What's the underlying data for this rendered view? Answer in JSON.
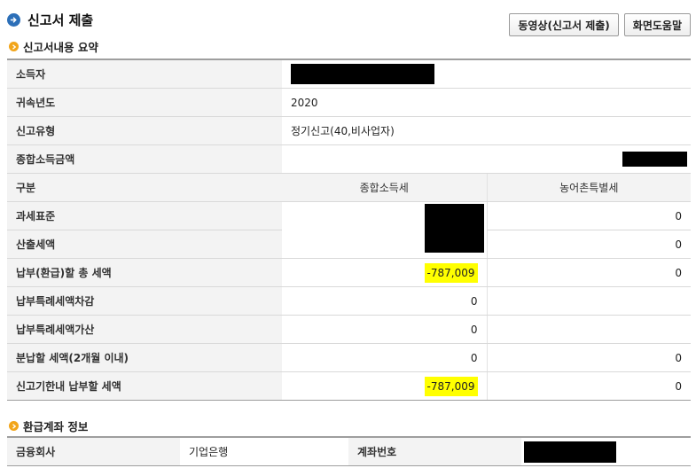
{
  "header": {
    "title": "신고서 제출",
    "icon": "arrow-right-circle-icon"
  },
  "buttons": {
    "video": "동영상(신고서 제출)",
    "help": "화면도움말"
  },
  "summary": {
    "title": "신고서내용 요약",
    "income_earner_label": "소득자",
    "year_label": "귀속년도",
    "year_value": "2020",
    "type_label": "신고유형",
    "type_value": "정기신고(40,비사업자)",
    "total_income_label": "종합소득금액",
    "columns": {
      "category": "구분",
      "income_tax": "종합소득세",
      "rural_tax": "농어촌특별세"
    },
    "rows": [
      {
        "label": "과세표준",
        "income_tax": "",
        "rural_tax": "0"
      },
      {
        "label": "산출세액",
        "income_tax": "",
        "rural_tax": "0"
      },
      {
        "label": "납부(환급)할 총 세액",
        "income_tax": "-787,009",
        "rural_tax": "0"
      },
      {
        "label": "납부특례세액차감",
        "income_tax": "0",
        "rural_tax": ""
      },
      {
        "label": "납부특례세액가산",
        "income_tax": "0",
        "rural_tax": ""
      },
      {
        "label": "분납할 세액(2개월 이내)",
        "income_tax": "0",
        "rural_tax": "0"
      },
      {
        "label": "신고기한내 납부할 세액",
        "income_tax": "-787,009",
        "rural_tax": "0"
      }
    ]
  },
  "refund": {
    "title": "환급계좌 정보",
    "bank_label": "금융회사",
    "bank_value": "기업은행",
    "account_label": "계좌번호"
  },
  "colors": {
    "highlight": "#ffff00",
    "bullet": "#f2a51a",
    "header_icon": "#2c6fb8"
  }
}
